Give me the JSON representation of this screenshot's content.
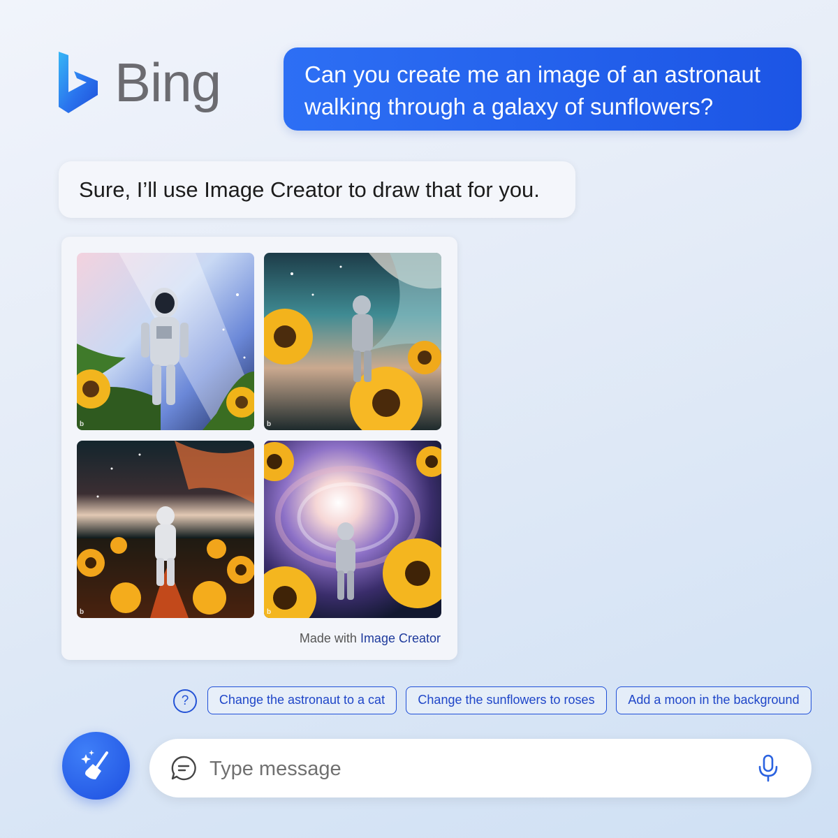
{
  "brand": {
    "name": "Bing"
  },
  "conversation": {
    "user_message": "Can you create me an image of an astronaut walking through a galaxy of sunflowers?",
    "bot_message": "Sure, I’ll use Image Creator to draw that for you."
  },
  "image_card": {
    "caption_prefix": "Made with",
    "caption_link": "Image Creator",
    "images": [
      {
        "badge": "b"
      },
      {
        "badge": "b"
      },
      {
        "badge": "b"
      },
      {
        "badge": "b"
      }
    ]
  },
  "suggestions": {
    "help_icon": "?",
    "chips": [
      "Change the astronaut to a cat",
      "Change the sunflowers to roses",
      "Add a moon in the background"
    ]
  },
  "composer": {
    "placeholder": "Type message",
    "new_topic_icon": "broom-sparkle-icon",
    "chat_icon": "chat-bubble-icon",
    "mic_icon": "microphone-icon"
  },
  "colors": {
    "accent": "#1c55e5",
    "chip_border": "#1f4fd8",
    "link": "#1e3a9c"
  }
}
